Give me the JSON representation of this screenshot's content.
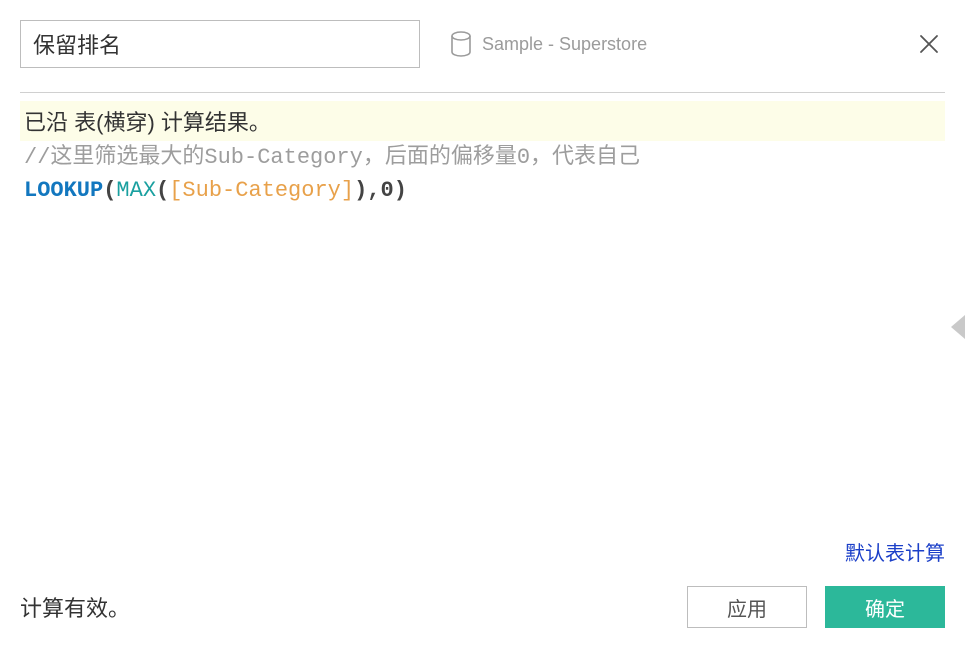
{
  "header": {
    "calc_name": "保留排名",
    "datasource_label": "Sample - Superstore"
  },
  "editor": {
    "scope_line": "已沿 表(横穿) 计算结果。",
    "comment": "//这里筛选最大的Sub-Category，后面的偏移量0，代表自己",
    "formula": {
      "func": "LOOKUP",
      "agg": "MAX",
      "field": "[Sub-Category]",
      "offset": "0"
    }
  },
  "footer": {
    "default_calc_link": "默认表计算",
    "status": "计算有效。",
    "apply_label": "应用",
    "ok_label": "确定"
  }
}
